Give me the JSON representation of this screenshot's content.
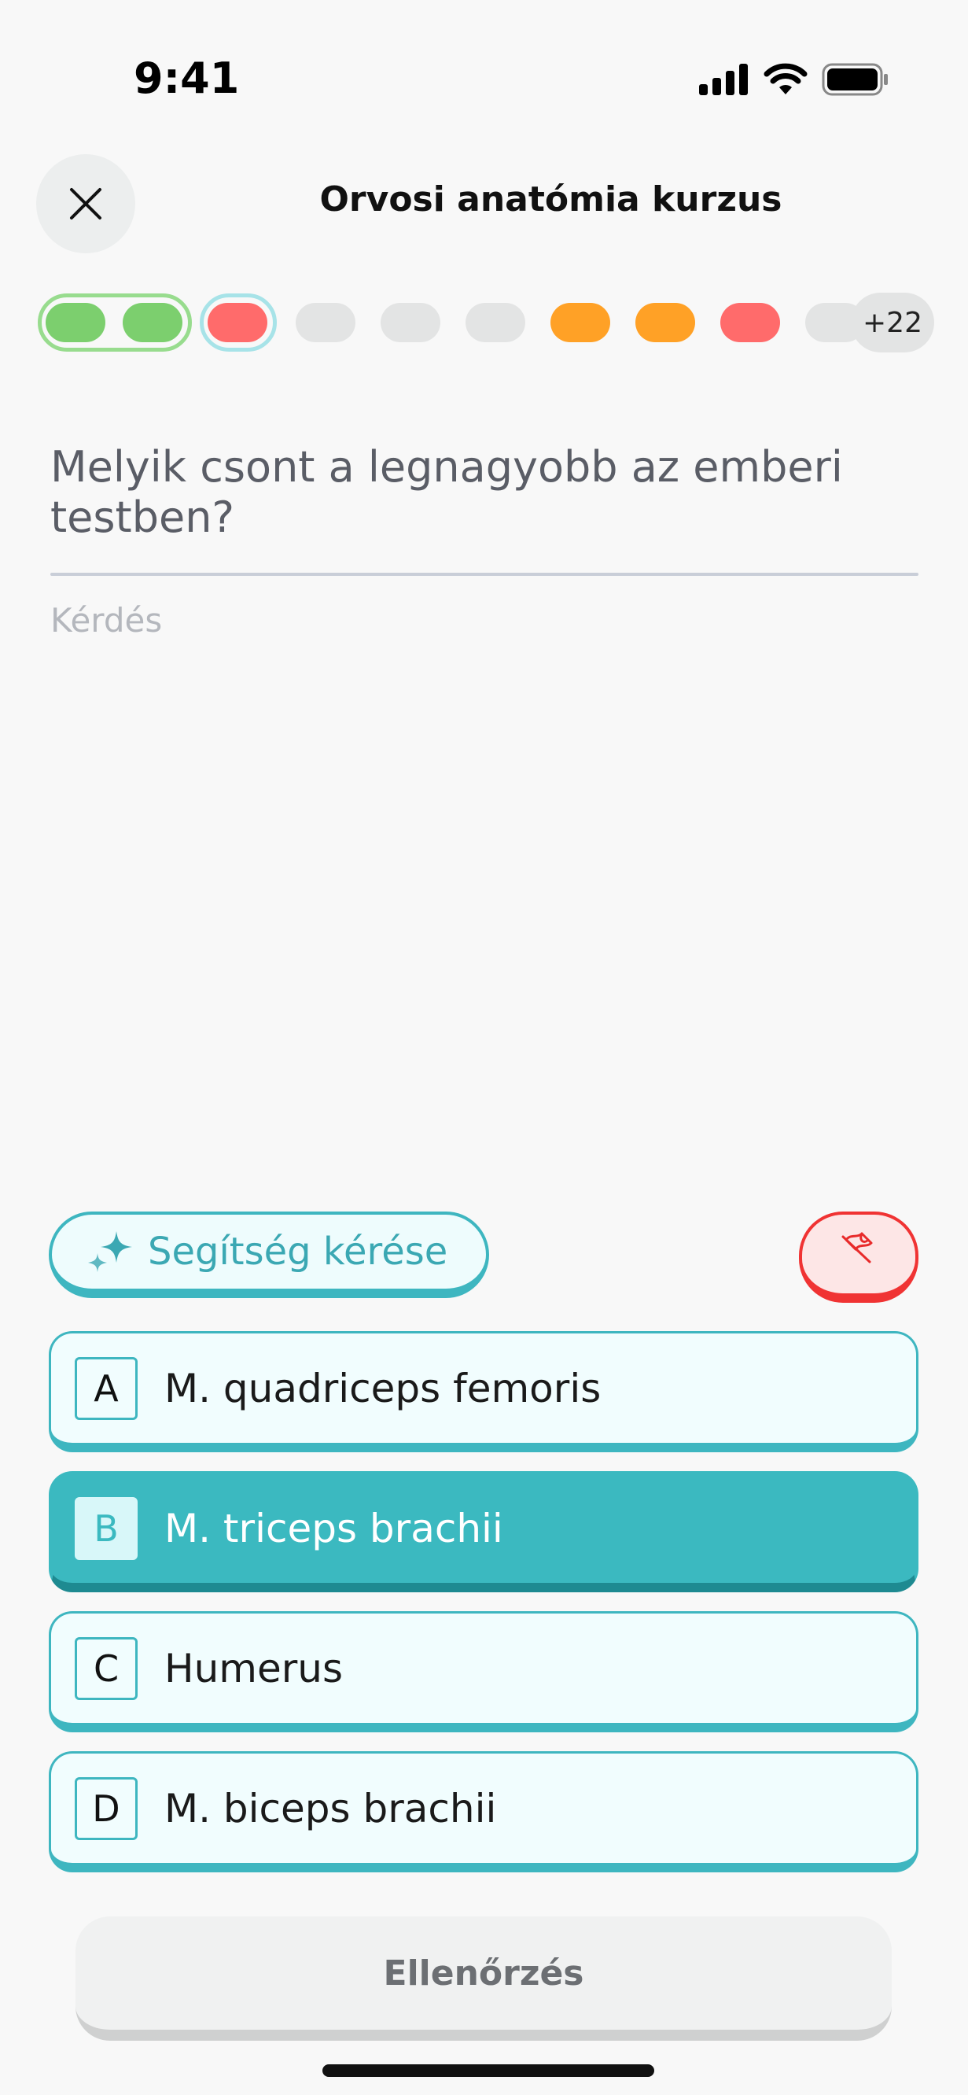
{
  "status_bar": {
    "time": "9:41"
  },
  "header": {
    "title": "Orvosi anatómia kurzus",
    "close_icon": "close-icon"
  },
  "progress": {
    "pills": [
      {
        "state": "correct",
        "color": "#7ccf6e"
      },
      {
        "state": "correct",
        "color": "#7ccf6e"
      },
      {
        "state": "current-wrong",
        "color": "#ff6b6b"
      },
      {
        "state": "pending",
        "color": "#e3e4e4"
      },
      {
        "state": "pending",
        "color": "#e3e4e4"
      },
      {
        "state": "pending",
        "color": "#e3e4e4"
      },
      {
        "state": "partial",
        "color": "#ffa126"
      },
      {
        "state": "partial",
        "color": "#ffa126"
      },
      {
        "state": "wrong",
        "color": "#ff6b6b"
      },
      {
        "state": "pending",
        "color": "#e3e4e4"
      }
    ],
    "more_count": "+22"
  },
  "question": {
    "text": "Melyik csont a legnagyobb az emberi testben?",
    "caption": "Kérdés"
  },
  "help_button": {
    "label": "Segítség kérése",
    "icon": "sparkle-icon"
  },
  "flag_button": {
    "icon": "flag-icon"
  },
  "answers": [
    {
      "letter": "A",
      "text": "M. quadriceps femoris",
      "selected": false
    },
    {
      "letter": "B",
      "text": "M. triceps brachii",
      "selected": true
    },
    {
      "letter": "C",
      "text": "Humerus",
      "selected": false
    },
    {
      "letter": "D",
      "text": "M. biceps brachii",
      "selected": false
    }
  ],
  "check_button": {
    "label": "Ellenőrzés"
  },
  "colors": {
    "accent": "#3bb9c0",
    "danger": "#f03333",
    "correct": "#7ccf6e",
    "partial": "#ffa126"
  }
}
